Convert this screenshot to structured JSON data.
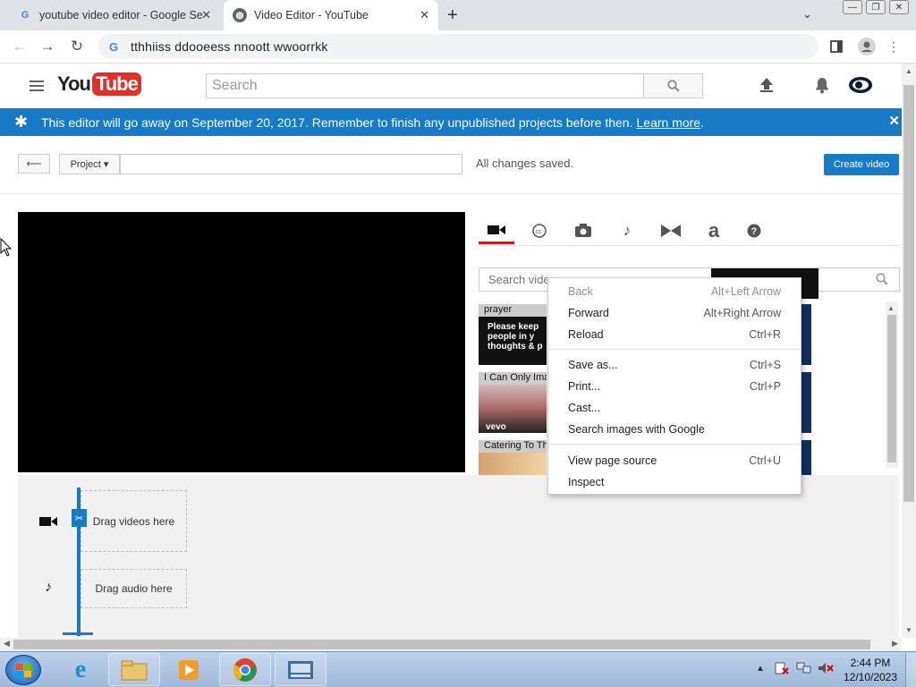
{
  "browser": {
    "tabs": [
      {
        "title": "youtube video editor - Google Se",
        "favicon": "google-icon"
      },
      {
        "title": "Video Editor - YouTube",
        "favicon": "globe-icon"
      }
    ],
    "address": "tthhiiss  ddooeess  nnoott  wwoorrkk"
  },
  "youtube": {
    "logo_you": "You",
    "logo_tube": "Tube",
    "search_placeholder": "Search"
  },
  "banner": {
    "message": "This editor will go away on September 20, 2017. Remember to finish any unpublished projects before then.",
    "link": "Learn more",
    "link_suffix": ".",
    "color": "#167ac6"
  },
  "editor": {
    "project_label": "Project",
    "status": "All changes saved.",
    "create_button": "Create video",
    "video_search_placeholder": "Search vide"
  },
  "media_tabs": [
    "video-camera-icon",
    "cc-icon",
    "camera-icon",
    "music-note-icon",
    "transitions-icon",
    "text-icon",
    "help-icon"
  ],
  "videos": [
    {
      "title": "prayer",
      "overlay": "Please keep\npeople in y\nthoughts & p"
    },
    {
      "title": "I Can Only Ima",
      "overlay": "vevo"
    },
    {
      "title": "Catering To Th",
      "overlay": ""
    }
  ],
  "timeline": {
    "video_drop": "Drag videos here",
    "audio_drop": "Drag audio here"
  },
  "context_menu": [
    {
      "label": "Back",
      "shortcut": "Alt+Left Arrow",
      "disabled": true
    },
    {
      "label": "Forward",
      "shortcut": "Alt+Right Arrow",
      "disabled": false
    },
    {
      "label": "Reload",
      "shortcut": "Ctrl+R",
      "disabled": false
    },
    {
      "label": "Save as...",
      "shortcut": "Ctrl+S",
      "disabled": false
    },
    {
      "label": "Print...",
      "shortcut": "Ctrl+P",
      "disabled": false
    },
    {
      "label": "Cast...",
      "shortcut": "",
      "disabled": false
    },
    {
      "label": "Search images with Google",
      "shortcut": "",
      "disabled": false
    },
    {
      "label": "View page source",
      "shortcut": "Ctrl+U",
      "disabled": false
    },
    {
      "label": "Inspect",
      "shortcut": "",
      "disabled": false
    }
  ],
  "taskbar": {
    "time": "2:44 PM",
    "date": "12/10/2023"
  }
}
